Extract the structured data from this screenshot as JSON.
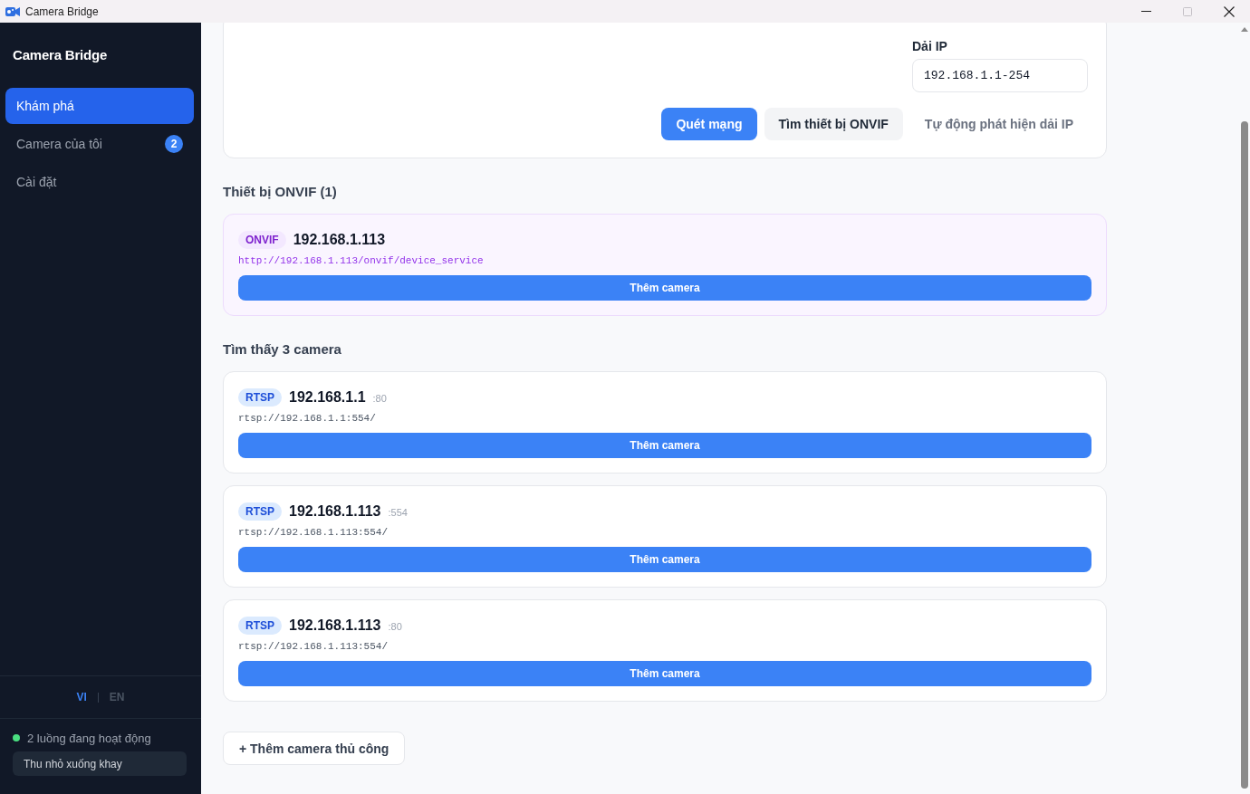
{
  "window": {
    "title": "Camera Bridge",
    "maximize_enabled": false
  },
  "sidebar": {
    "brand": "Camera Bridge",
    "items": [
      {
        "label": "Khám phá",
        "selected": true
      },
      {
        "label": "Camera của tôi",
        "selected": false,
        "badge": "2"
      },
      {
        "label": "Cài đặt",
        "selected": false
      }
    ],
    "languages": [
      {
        "label": "VI",
        "selected": true
      },
      {
        "label": "EN",
        "selected": false
      }
    ],
    "status": {
      "text": "2 luồng đang hoạt động",
      "active": true
    },
    "tray_button": "Thu nhỏ xuống khay"
  },
  "scan": {
    "ip_range": {
      "label": "Dải IP",
      "value": "192.168.1.1-254"
    },
    "actions": [
      {
        "label": "Quét mạng",
        "kind": "primary"
      },
      {
        "label": "Tìm thiết bị ONVIF",
        "kind": "secondary"
      },
      {
        "label": "Tự động phát hiện dải IP",
        "kind": "link"
      }
    ]
  },
  "sections": [
    {
      "title": "Thiết bị ONVIF (1)",
      "devices": [
        {
          "kind": "onvif",
          "badge": "ONVIF",
          "ip": "192.168.1.113",
          "url": "http://192.168.1.113/onvif/device_service",
          "button": "Thêm camera"
        }
      ]
    },
    {
      "title": "Tìm thấy 3 camera",
      "devices": [
        {
          "kind": "rtsp",
          "badge": "RTSP",
          "ip": "192.168.1.1",
          "port": ":80",
          "url": "rtsp://192.168.1.1:554/",
          "button": "Thêm camera"
        },
        {
          "kind": "rtsp",
          "badge": "RTSP",
          "ip": "192.168.1.113",
          "port": ":554",
          "url": "rtsp://192.168.1.113:554/",
          "button": "Thêm camera"
        },
        {
          "kind": "rtsp",
          "badge": "RTSP",
          "ip": "192.168.1.113",
          "port": ":80",
          "url": "rtsp://192.168.1.113:554/",
          "button": "Thêm camera"
        }
      ]
    }
  ],
  "manual_add_button": "+ Thêm camera thủ công"
}
